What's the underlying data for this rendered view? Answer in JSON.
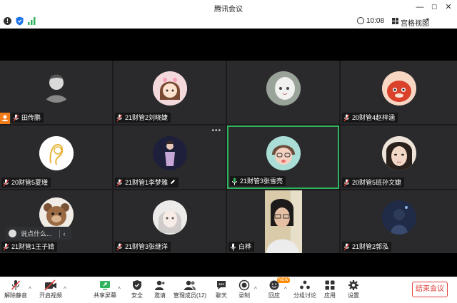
{
  "window": {
    "title": "腾讯会议",
    "minimize_glyph": "—",
    "maximize_glyph": "☐",
    "close_glyph": "✕"
  },
  "infobar": {
    "info_icon": "info-icon",
    "shield_icon": "shield-icon",
    "signal_icon": "signal-icon",
    "time": "10:08",
    "view_label": "宫格视图",
    "view_chevron": "▾"
  },
  "participants": [
    {
      "name": "田传鹏",
      "host": true,
      "muted": true,
      "avatar": "man-portrait"
    },
    {
      "name": "21财管2刘晓婕",
      "muted": true,
      "avatar": "cartoon-girl"
    },
    {
      "name": "",
      "muted": false,
      "avatar": "white-cat"
    },
    {
      "name": "20财管4赵梓涵",
      "muted": true,
      "avatar": "red-panda"
    },
    {
      "name": "20财管5夏瑾",
      "muted": true,
      "avatar": "yellow-line-art"
    },
    {
      "name": "21财管1李梦雅",
      "muted": true,
      "avatar": "girl-standing",
      "more": "•••",
      "editing": true
    },
    {
      "name": "21财管3张雪亮",
      "muted": false,
      "speaking": true,
      "avatar": "cartoon-boy"
    },
    {
      "name": "20财管5班孙文婕",
      "muted": true,
      "avatar": "face-closeup"
    },
    {
      "name": "21财管1王子婧",
      "muted": true,
      "avatar": "teddy-bear"
    },
    {
      "name": "21财管3张继洋",
      "muted": true,
      "avatar": "anime-girl"
    },
    {
      "name": "白桦",
      "muted": true,
      "avatar": "video-feed"
    },
    {
      "name": "21财管2郭泓",
      "muted": true,
      "avatar": "dark-figure"
    }
  ],
  "chat_popup": {
    "placeholder": "说点什么...",
    "back_glyph": "‹"
  },
  "toolbar": {
    "items": [
      {
        "label": "解除静音",
        "icon": "mic-muted-icon"
      },
      {
        "label": "开启视频",
        "icon": "camera-off-icon"
      },
      {
        "label": "共享屏幕",
        "icon": "share-screen-icon"
      },
      {
        "label": "安全",
        "icon": "shield-icon"
      },
      {
        "label": "邀请",
        "icon": "invite-icon"
      },
      {
        "label": "管理成员(12)",
        "icon": "members-icon"
      },
      {
        "label": "聊天",
        "icon": "chat-icon"
      },
      {
        "label": "录制",
        "icon": "record-icon"
      },
      {
        "label": "回应",
        "icon": "reaction-icon"
      },
      {
        "label": "分组讨论",
        "icon": "breakout-icon"
      },
      {
        "label": "应用",
        "icon": "apps-icon"
      },
      {
        "label": "设置",
        "icon": "settings-icon"
      }
    ],
    "chevron": "^",
    "new_badge": "NEW",
    "end_label": "结束会议",
    "colors": {
      "end": "#e0423f",
      "share": "#2fb35d",
      "muted": "#e0423f"
    }
  }
}
